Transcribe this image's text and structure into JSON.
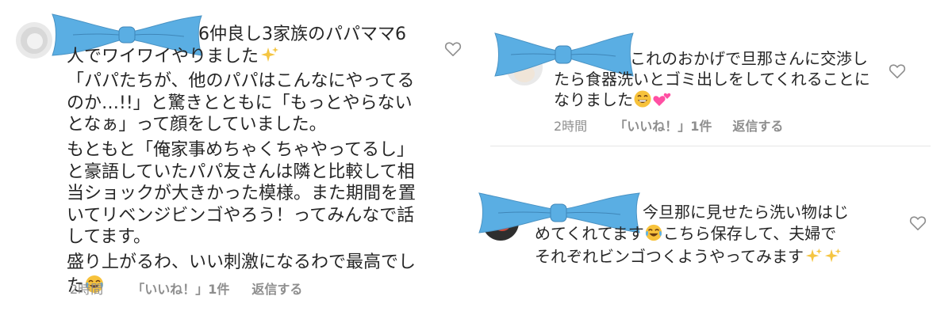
{
  "comments": [
    {
      "avatar": "user-avatar",
      "name_fragment": "6",
      "lines": [
        "仲良し3家族のパパママ6",
        "人でワイワイやりました",
        "「パパたちが、他のパパはこんなにやってる",
        "のか…!!」と驚きとともに「もっとやらない",
        "となぁ」って顔をしていました。",
        "もともと「俺家事めちゃくちゃやってるし」",
        "と豪語していたパパ友さんは隣と比較して相",
        "当ショックが大きかった模様。また期間を置",
        "いてリベンジビンゴやろう！ってみんなで話",
        "してます。",
        "盛り上がるわ、いい刺激になるわで最高でし",
        "た"
      ],
      "time": "2時間",
      "likes": "「いいね！」1件",
      "reply": "返信する"
    },
    {
      "avatar": "user-avatar",
      "lines": [
        "これのおかげで旦那さんに交渉し",
        "たら食器洗いとゴミ出しをしてくれることに",
        "なりました"
      ],
      "time": "2時間",
      "likes": "「いいね！」1件",
      "reply": "返信する"
    },
    {
      "avatar": "user-avatar",
      "lines": [
        "今旦那に見せたら洗い物はじ",
        "めてくれてます",
        "こちら保存して、夫婦で",
        "それぞれビンゴつくようやってみます"
      ]
    }
  ],
  "icons": {
    "like": "heart-outline-icon",
    "sparkles": "sparkles-icon",
    "laugh": "face-with-tears-of-joy-icon",
    "grin": "grinning-face-icon",
    "hearts": "two-hearts-icon"
  },
  "colors": {
    "redaction": "#5aaee3",
    "meta": "#8e8e8e",
    "heart_stroke": "#8e8e8e",
    "sparkle": "#f5c542",
    "pink": "#ff4fa3",
    "emoji_face": "#f7c23b"
  }
}
